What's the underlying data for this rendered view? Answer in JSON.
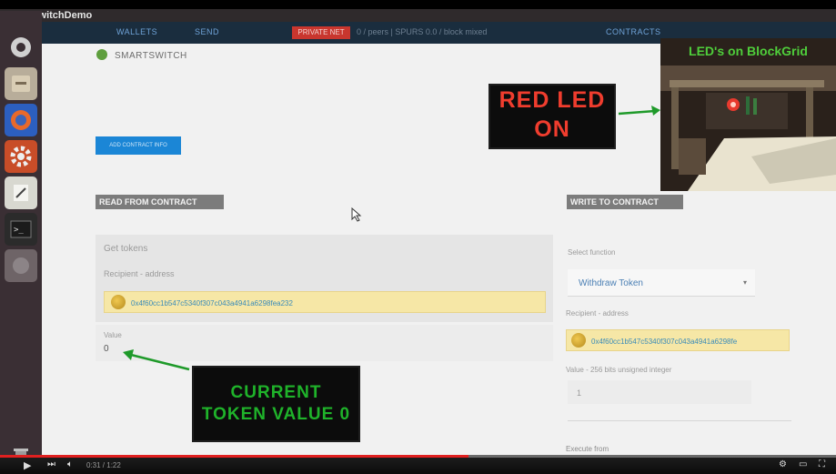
{
  "window": {
    "title": "SmartSwitchDemo"
  },
  "navbar": {
    "items": [
      "WALLETS",
      "SEND",
      "CONTRACTS"
    ],
    "network_badge": "PRIVATE NET",
    "network_info": "0 / peers | SPURS 0.0 / block mixed"
  },
  "app": {
    "name": "SMARTSWITCH"
  },
  "buttons": {
    "add_contract": "ADD CONTRACT INFO"
  },
  "read": {
    "header": "READ FROM CONTRACT",
    "function_label": "Get tokens",
    "recipient_label": "Recipient - address",
    "recipient_value": "0x4f60cc1b547c5340f307c043a4941a6298fea232",
    "value_label": "Value",
    "value": "0"
  },
  "write": {
    "header": "WRITE TO CONTRACT",
    "select_label": "Select function",
    "selected_function": "Withdraw Token",
    "recipient_label": "Recipient - address",
    "recipient_value": "0x4f60cc1b547c5340f307c043a4941a6298fe",
    "amount_label": "Value - 256 bits unsigned integer",
    "amount_value": "1",
    "execute_label": "Execute from"
  },
  "overlays": {
    "red_led_line1": "RED LED",
    "red_led_line2": "ON",
    "current_line1": "CURRENT",
    "current_line2": "TOKEN VALUE 0",
    "inset_caption": "LED's on BlockGrid"
  },
  "player": {
    "progress": 0.56,
    "time": "0:31 / 1:22",
    "colors": {
      "progress": "#e02020"
    }
  },
  "colors": {
    "navbar": "#1a2d3e",
    "accent_blue": "#1b86d6",
    "annotation_green": "#1fb32a",
    "annotation_red": "#f03d2e"
  }
}
